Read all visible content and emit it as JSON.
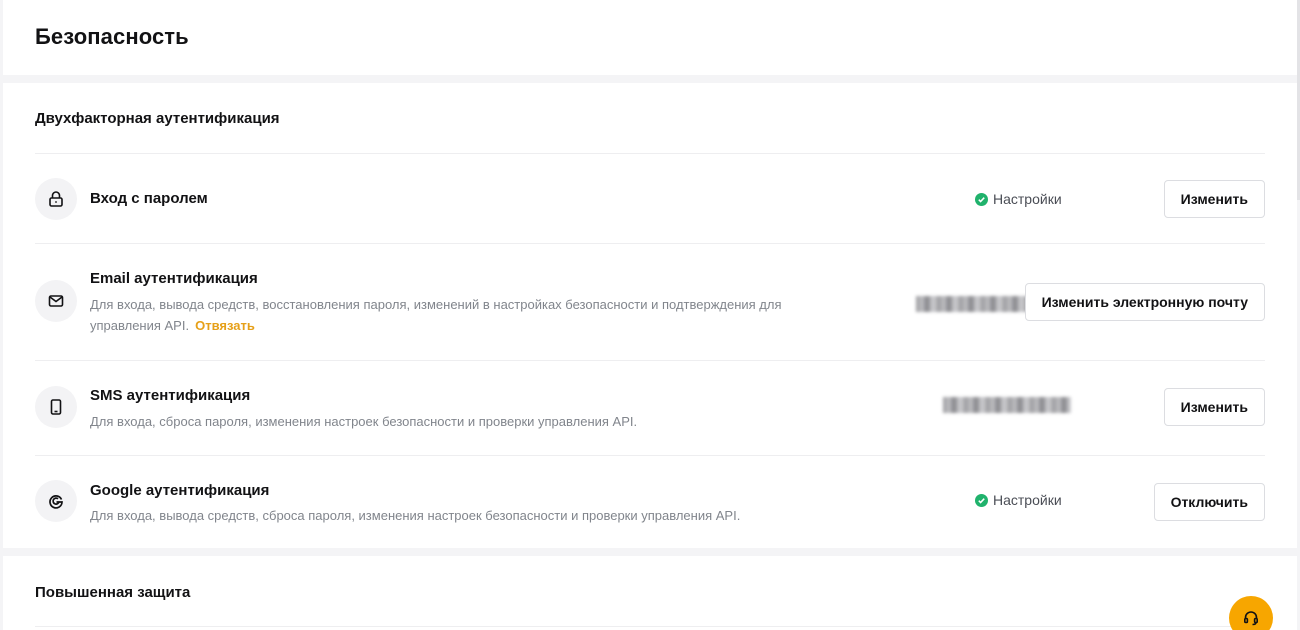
{
  "page": {
    "title": "Безопасность"
  },
  "two_factor": {
    "title": "Двухфакторная аутентификация",
    "items": [
      {
        "icon": "lock-icon",
        "title": "Вход с паролем",
        "status": "Настройки",
        "button": "Изменить"
      },
      {
        "icon": "mail-icon",
        "title": "Email аутентификация",
        "description": "Для входа, вывода средств, восстановления пароля, изменений в настройках безопасности и подтверждения для управления API.",
        "unbind_label": "Отвязать",
        "button": "Изменить электронную почту"
      },
      {
        "icon": "phone-icon",
        "title": "SMS аутентификация",
        "description": "Для входа, сброса пароля, изменения настроек безопасности и проверки управления API.",
        "button": "Изменить"
      },
      {
        "icon": "google-icon",
        "title": "Google аутентификация",
        "description": "Для входа, вывода средств, сброса пароля, изменения настроек безопасности и проверки управления API.",
        "status": "Настройки",
        "button": "Отключить"
      }
    ]
  },
  "advanced": {
    "title": "Повышенная защита"
  },
  "colors": {
    "status_ok": "#20b26c",
    "accent": "#f7a600",
    "link": "#e6a019"
  }
}
